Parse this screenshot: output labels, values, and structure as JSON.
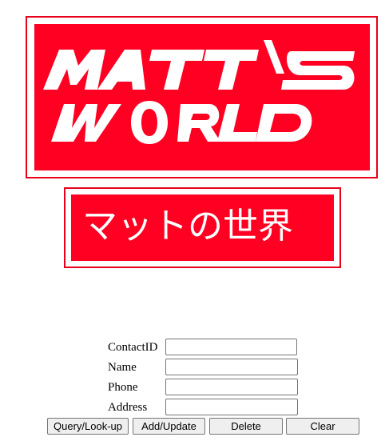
{
  "logo": {
    "line1": "MATT'S",
    "line2": "WORLD",
    "japanese": "マットの世界",
    "colors": {
      "red": "#ff0022",
      "border": "#e8001a",
      "white": "#ffffff"
    }
  },
  "form": {
    "fields": [
      {
        "label": "ContactID",
        "value": "",
        "placeholder": ""
      },
      {
        "label": "Name",
        "value": "",
        "placeholder": ""
      },
      {
        "label": "Phone",
        "value": "",
        "placeholder": ""
      },
      {
        "label": "Address",
        "value": "",
        "placeholder": ""
      }
    ],
    "buttons": {
      "query": "Query/Look-up",
      "add_update": "Add/Update",
      "delete": "Delete",
      "clear": "Clear"
    }
  }
}
